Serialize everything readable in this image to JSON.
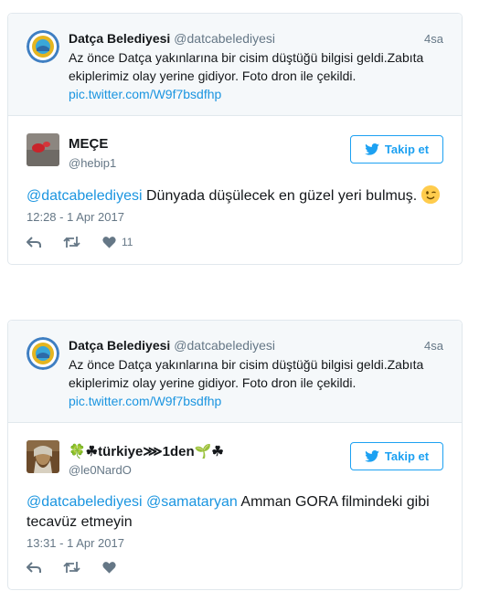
{
  "tweets": [
    {
      "quoted": {
        "name": "Datça Belediyesi",
        "handle": "@datcabelediyesi",
        "time": "4sa",
        "text": "Az önce Datça yakınlarına bir cisim düştüğü bilgisi geldi.Zabıta ekiplerimiz olay yerine gidiyor. Foto dron ile çekildi.",
        "link": "pic.twitter.com/W9f7bsdfhp"
      },
      "reply": {
        "name": "MEÇE",
        "handle": "@hebip1",
        "follow_label": "Takip et",
        "mention": "@datcabelediyesi",
        "text": " Dünyada düşülecek en güzel yeri bulmuş. ",
        "date": "12:28 - 1 Apr 2017",
        "likes": "11"
      }
    },
    {
      "quoted": {
        "name": "Datça Belediyesi",
        "handle": "@datcabelediyesi",
        "time": "4sa",
        "text": "Az önce Datça yakınlarına bir cisim düştüğü bilgisi geldi.Zabıta ekiplerimiz olay yerine gidiyor. Foto dron ile çekildi.",
        "link": "pic.twitter.com/W9f7bsdfhp"
      },
      "reply": {
        "name": "🍀☘türkiye⋙1den🌱☘",
        "handle": "@le0NardO",
        "follow_label": "Takip et",
        "mention": "@datcabelediyesi @samataryan",
        "text": " Amman GORA filmindeki gibi tecavüz etmeyin",
        "date": "13:31 - 1 Apr 2017",
        "likes": ""
      }
    }
  ],
  "colors": {
    "accent": "#1da1f2",
    "link": "#1b95e0",
    "muted": "#657786"
  },
  "icons": [
    "twitter-bird-icon",
    "reply-icon",
    "retweet-icon",
    "heart-icon",
    "wink-emoji-icon"
  ]
}
